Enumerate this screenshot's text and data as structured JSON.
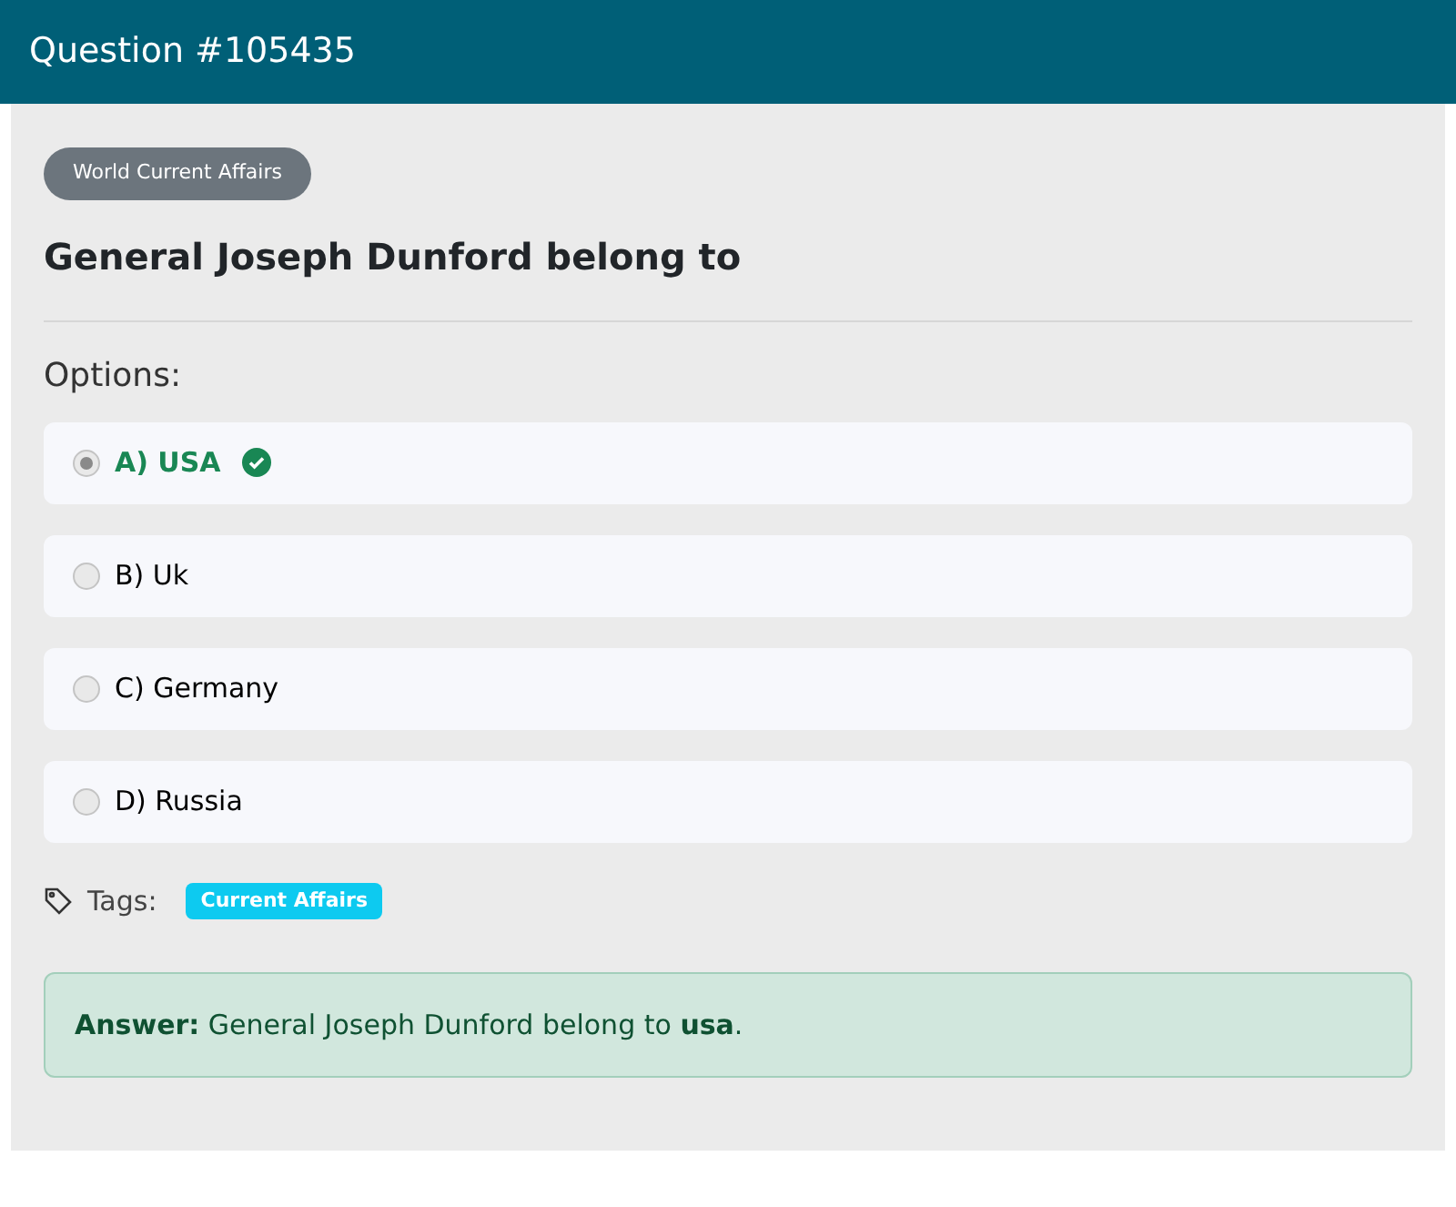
{
  "header": {
    "title": "Question #105435"
  },
  "category": "World Current Affairs",
  "question": "General Joseph Dunford belong to",
  "options_label": "Options:",
  "options": [
    {
      "label": "A) USA",
      "selected": true,
      "correct": true
    },
    {
      "label": "B) Uk",
      "selected": false,
      "correct": false
    },
    {
      "label": "C) Germany",
      "selected": false,
      "correct": false
    },
    {
      "label": "D) Russia",
      "selected": false,
      "correct": false
    }
  ],
  "tags_label": "Tags:",
  "tags": [
    "Current Affairs"
  ],
  "answer": "**Answer:** General Joseph Dunford belong to **usa**."
}
